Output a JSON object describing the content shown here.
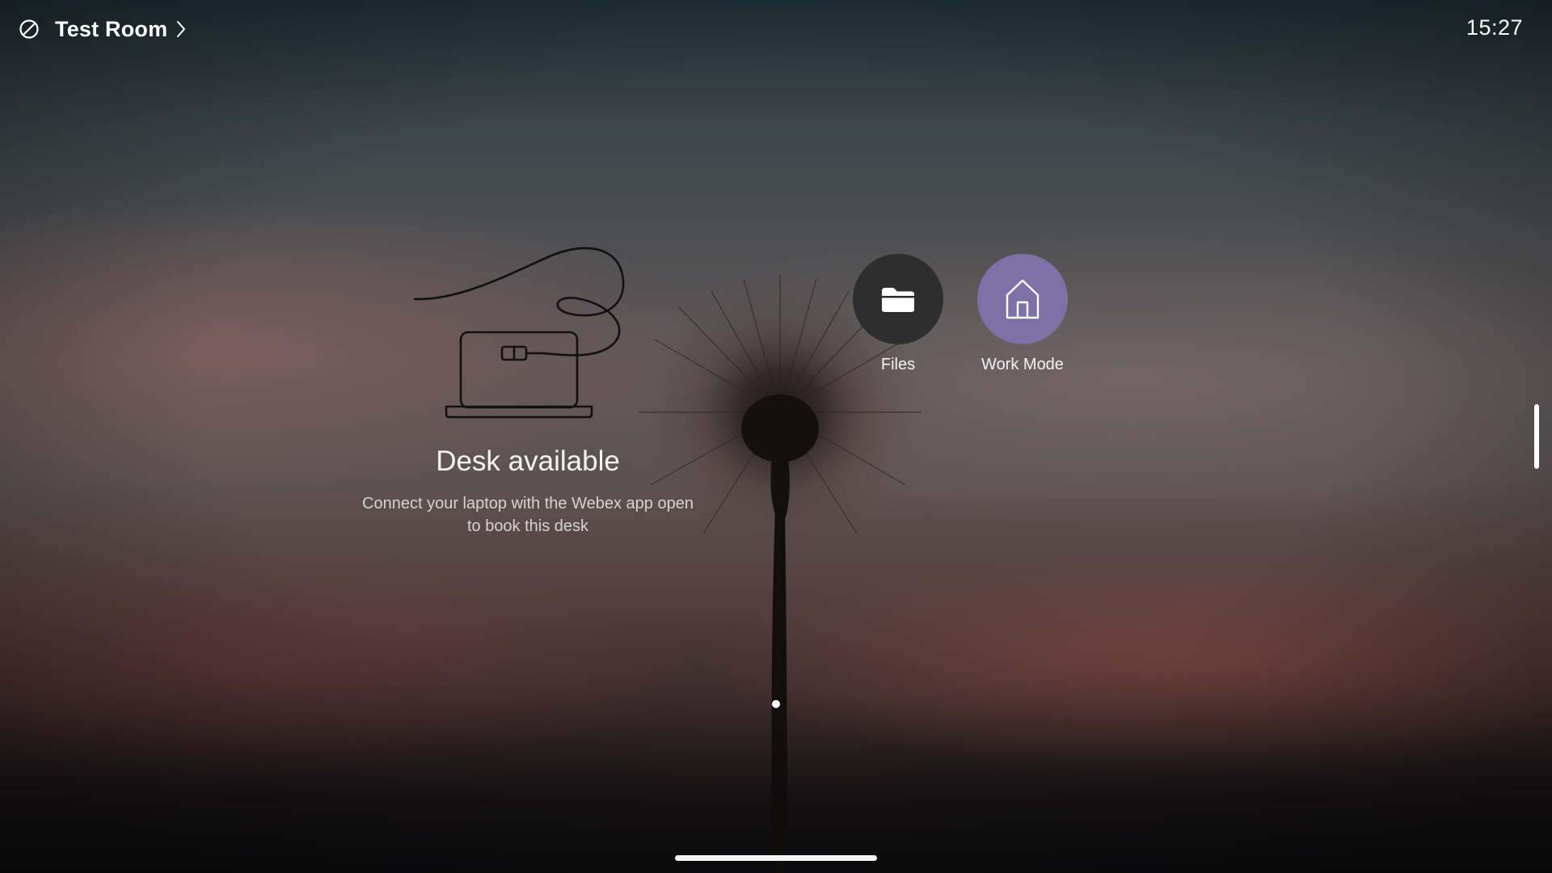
{
  "header": {
    "status_icon": "do-not-disturb-icon",
    "room_name": "Test Room",
    "chevron_icon": "chevron-right-icon",
    "time": "15:27"
  },
  "desk": {
    "illustration_icon": "laptop-cable-icon",
    "title": "Desk available",
    "subtitle_line1": "Connect your laptop with the Webex app open",
    "subtitle_line2": "to book this desk"
  },
  "apps": [
    {
      "label": "Files",
      "icon": "folder-icon",
      "color": "#2e2e2e"
    },
    {
      "label": "Work Mode",
      "icon": "home-icon",
      "color": "#7c72a8"
    }
  ],
  "pagination": {
    "page": 1,
    "total": 1
  }
}
